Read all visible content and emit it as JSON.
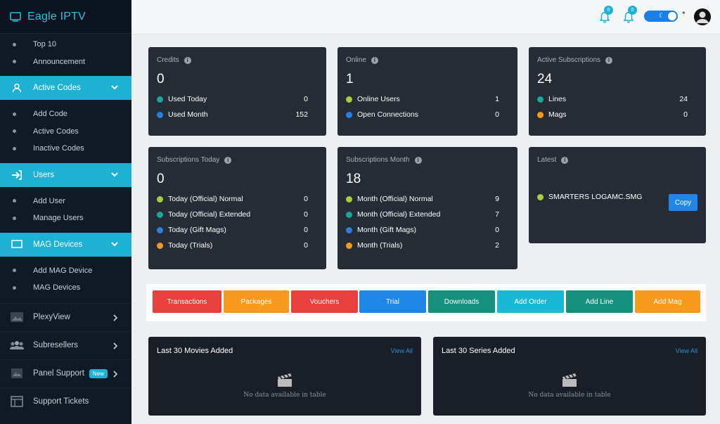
{
  "app": {
    "title": "Eagle IPTV"
  },
  "sidebar": {
    "top_items": [
      "Top 10",
      "Announcement"
    ],
    "active_codes": {
      "label": "Active Codes",
      "items": [
        "Add Code",
        "Active Codes",
        "Inactive Codes"
      ]
    },
    "users": {
      "label": "Users",
      "items": [
        "Add User",
        "Manage Users"
      ]
    },
    "mag": {
      "label": "MAG Devices",
      "items": [
        "Add MAG Device",
        "MAG Devices"
      ]
    },
    "plexy": "PlexyView",
    "subresellers": "Subresellers",
    "panel_support": "Panel Support",
    "panel_support_badge": "New",
    "support_tickets": "Support Tickets"
  },
  "topbar": {
    "notif1": "0",
    "notif2": "0",
    "theme": "dark"
  },
  "cards": {
    "credits": {
      "title": "Credits",
      "value": "0",
      "rows": [
        {
          "label": "Used Today",
          "value": "0",
          "color": "#1aa69a"
        },
        {
          "label": "Used Month",
          "value": "152",
          "color": "#2a7fe0"
        }
      ]
    },
    "online": {
      "title": "Online",
      "value": "1",
      "rows": [
        {
          "label": "Online Users",
          "value": "1",
          "color": "#a8cc3c"
        },
        {
          "label": "Open Connections",
          "value": "0",
          "color": "#2a7fe0"
        }
      ]
    },
    "active_subs": {
      "title": "Active Subscriptions",
      "value": "24",
      "rows": [
        {
          "label": "Lines",
          "value": "24",
          "color": "#1aa69a"
        },
        {
          "label": "Mags",
          "value": "0",
          "color": "#f29a1e"
        }
      ]
    },
    "subs_today": {
      "title": "Subscriptions Today",
      "value": "0",
      "rows": [
        {
          "label": "Today (Official) Normal",
          "value": "0",
          "color": "#a8cc3c"
        },
        {
          "label": "Today (Official) Extended",
          "value": "0",
          "color": "#1aa69a"
        },
        {
          "label": "Today (Gift Mags)",
          "value": "0",
          "color": "#2a7fe0"
        },
        {
          "label": "Today (Trials)",
          "value": "0",
          "color": "#f29a1e"
        }
      ]
    },
    "subs_month": {
      "title": "Subscriptions Month",
      "value": "18",
      "rows": [
        {
          "label": "Month (Official) Normal",
          "value": "9",
          "color": "#a8cc3c"
        },
        {
          "label": "Month (Official) Extended",
          "value": "7",
          "color": "#1aa69a"
        },
        {
          "label": "Month (Gift Mags)",
          "value": "0",
          "color": "#2a7fe0"
        },
        {
          "label": "Month (Trials)",
          "value": "2",
          "color": "#f29a1e"
        }
      ]
    },
    "latest": {
      "title": "Latest",
      "item": "SMARTERS LOGAMC.SMG",
      "item_color": "#a8cc3c",
      "copy": "Copy"
    }
  },
  "quick_buttons": [
    {
      "label": "Transactions",
      "color": "#e8403c"
    },
    {
      "label": "Packages",
      "color": "#f79a1e"
    },
    {
      "label": "Vouchers",
      "color": "#e8403c"
    },
    {
      "label": "Trial",
      "color": "#1f86e6"
    },
    {
      "label": "Downloads",
      "color": "#15907c"
    },
    {
      "label": "Add Order",
      "color": "#19b9d6"
    },
    {
      "label": "Add Line",
      "color": "#15907c"
    },
    {
      "label": "Add Mag",
      "color": "#f79a1e"
    }
  ],
  "panels": {
    "movies": {
      "title": "Last 30 Movies Added",
      "link": "View All",
      "empty": "No data available in table"
    },
    "series": {
      "title": "Last 30 Series Added",
      "link": "View All",
      "empty": "No data available in table"
    }
  }
}
